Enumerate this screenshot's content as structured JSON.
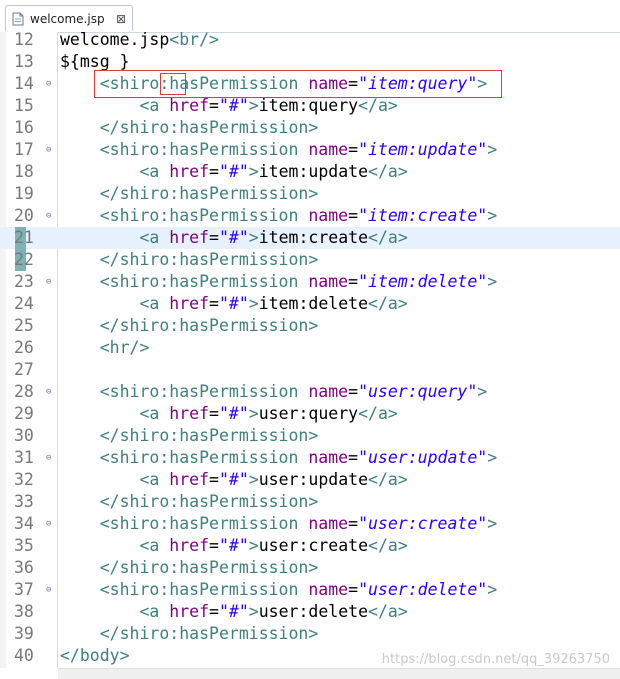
{
  "tab": {
    "title": "welcome.jsp",
    "close": "⊠"
  },
  "lines": [
    {
      "n": "12",
      "fold": "",
      "parts": [
        [
          "txt",
          "welcome.jsp"
        ],
        [
          "tag",
          "<br/>"
        ]
      ]
    },
    {
      "n": "13",
      "fold": "",
      "parts": [
        [
          "txt",
          "${msg }"
        ]
      ]
    },
    {
      "n": "14",
      "fold": "⊖",
      "parts": [
        [
          "txt",
          "    "
        ],
        [
          "tag",
          "<shiro:hasPermission "
        ],
        [
          "attr",
          "name"
        ],
        [
          "txt",
          "="
        ],
        [
          "str",
          "\"item:query\""
        ],
        [
          "tag",
          ">"
        ]
      ]
    },
    {
      "n": "15",
      "fold": "",
      "parts": [
        [
          "txt",
          "        "
        ],
        [
          "tag",
          "<a "
        ],
        [
          "attr",
          "href"
        ],
        [
          "txt",
          "="
        ],
        [
          "str",
          "\"#\""
        ],
        [
          "tag",
          ">"
        ],
        [
          "txt",
          "item:query"
        ],
        [
          "tag",
          "</a>"
        ]
      ]
    },
    {
      "n": "16",
      "fold": "",
      "parts": [
        [
          "txt",
          "    "
        ],
        [
          "tag",
          "</shiro:hasPermission>"
        ]
      ]
    },
    {
      "n": "17",
      "fold": "⊖",
      "parts": [
        [
          "txt",
          "    "
        ],
        [
          "tag",
          "<shiro:hasPermission "
        ],
        [
          "attr",
          "name"
        ],
        [
          "txt",
          "="
        ],
        [
          "str",
          "\"item:update\""
        ],
        [
          "tag",
          ">"
        ]
      ]
    },
    {
      "n": "18",
      "fold": "",
      "parts": [
        [
          "txt",
          "        "
        ],
        [
          "tag",
          "<a "
        ],
        [
          "attr",
          "href"
        ],
        [
          "txt",
          "="
        ],
        [
          "str",
          "\"#\""
        ],
        [
          "tag",
          ">"
        ],
        [
          "txt",
          "item:update"
        ],
        [
          "tag",
          "</a>"
        ]
      ]
    },
    {
      "n": "19",
      "fold": "",
      "parts": [
        [
          "txt",
          "    "
        ],
        [
          "tag",
          "</shiro:hasPermission>"
        ]
      ]
    },
    {
      "n": "20",
      "fold": "⊖",
      "parts": [
        [
          "txt",
          "    "
        ],
        [
          "tag",
          "<shiro:hasPermission "
        ],
        [
          "attr",
          "name"
        ],
        [
          "txt",
          "="
        ],
        [
          "str",
          "\"item:create\""
        ],
        [
          "tag",
          ">"
        ]
      ]
    },
    {
      "n": "21",
      "fold": "",
      "current": true,
      "parts": [
        [
          "txt",
          "        "
        ],
        [
          "tag",
          "<a "
        ],
        [
          "attr",
          "href"
        ],
        [
          "txt",
          "="
        ],
        [
          "str",
          "\"#\""
        ],
        [
          "tag",
          ">"
        ],
        [
          "txt",
          "item:create"
        ],
        [
          "tag",
          "</a>"
        ]
      ]
    },
    {
      "n": "22",
      "fold": "",
      "parts": [
        [
          "txt",
          "    "
        ],
        [
          "tag",
          "</shiro:hasPermission>"
        ]
      ]
    },
    {
      "n": "23",
      "fold": "⊖",
      "parts": [
        [
          "txt",
          "    "
        ],
        [
          "tag",
          "<shiro:hasPermission "
        ],
        [
          "attr",
          "name"
        ],
        [
          "txt",
          "="
        ],
        [
          "str",
          "\"item:delete\""
        ],
        [
          "tag",
          ">"
        ]
      ]
    },
    {
      "n": "24",
      "fold": "",
      "parts": [
        [
          "txt",
          "        "
        ],
        [
          "tag",
          "<a "
        ],
        [
          "attr",
          "href"
        ],
        [
          "txt",
          "="
        ],
        [
          "str",
          "\"#\""
        ],
        [
          "tag",
          ">"
        ],
        [
          "txt",
          "item:delete"
        ],
        [
          "tag",
          "</a>"
        ]
      ]
    },
    {
      "n": "25",
      "fold": "",
      "parts": [
        [
          "txt",
          "    "
        ],
        [
          "tag",
          "</shiro:hasPermission>"
        ]
      ]
    },
    {
      "n": "26",
      "fold": "",
      "parts": [
        [
          "txt",
          "    "
        ],
        [
          "tag",
          "<hr/>"
        ]
      ]
    },
    {
      "n": "27",
      "fold": "",
      "parts": []
    },
    {
      "n": "28",
      "fold": "⊖",
      "parts": [
        [
          "txt",
          "    "
        ],
        [
          "tag",
          "<shiro:hasPermission "
        ],
        [
          "attr",
          "name"
        ],
        [
          "txt",
          "="
        ],
        [
          "str",
          "\"user:query\""
        ],
        [
          "tag",
          ">"
        ]
      ]
    },
    {
      "n": "29",
      "fold": "",
      "parts": [
        [
          "txt",
          "        "
        ],
        [
          "tag",
          "<a "
        ],
        [
          "attr",
          "href"
        ],
        [
          "txt",
          "="
        ],
        [
          "str",
          "\"#\""
        ],
        [
          "tag",
          ">"
        ],
        [
          "txt",
          "user:query"
        ],
        [
          "tag",
          "</a>"
        ]
      ]
    },
    {
      "n": "30",
      "fold": "",
      "parts": [
        [
          "txt",
          "    "
        ],
        [
          "tag",
          "</shiro:hasPermission>"
        ]
      ]
    },
    {
      "n": "31",
      "fold": "⊖",
      "parts": [
        [
          "txt",
          "    "
        ],
        [
          "tag",
          "<shiro:hasPermission "
        ],
        [
          "attr",
          "name"
        ],
        [
          "txt",
          "="
        ],
        [
          "str",
          "\"user:update\""
        ],
        [
          "tag",
          ">"
        ]
      ]
    },
    {
      "n": "32",
      "fold": "",
      "parts": [
        [
          "txt",
          "        "
        ],
        [
          "tag",
          "<a "
        ],
        [
          "attr",
          "href"
        ],
        [
          "txt",
          "="
        ],
        [
          "str",
          "\"#\""
        ],
        [
          "tag",
          ">"
        ],
        [
          "txt",
          "user:update"
        ],
        [
          "tag",
          "</a>"
        ]
      ]
    },
    {
      "n": "33",
      "fold": "",
      "parts": [
        [
          "txt",
          "    "
        ],
        [
          "tag",
          "</shiro:hasPermission>"
        ]
      ]
    },
    {
      "n": "34",
      "fold": "⊖",
      "parts": [
        [
          "txt",
          "    "
        ],
        [
          "tag",
          "<shiro:hasPermission "
        ],
        [
          "attr",
          "name"
        ],
        [
          "txt",
          "="
        ],
        [
          "str",
          "\"user:create\""
        ],
        [
          "tag",
          ">"
        ]
      ]
    },
    {
      "n": "35",
      "fold": "",
      "parts": [
        [
          "txt",
          "        "
        ],
        [
          "tag",
          "<a "
        ],
        [
          "attr",
          "href"
        ],
        [
          "txt",
          "="
        ],
        [
          "str",
          "\"#\""
        ],
        [
          "tag",
          ">"
        ],
        [
          "txt",
          "user:create"
        ],
        [
          "tag",
          "</a>"
        ]
      ]
    },
    {
      "n": "36",
      "fold": "",
      "parts": [
        [
          "txt",
          "    "
        ],
        [
          "tag",
          "</shiro:hasPermission>"
        ]
      ]
    },
    {
      "n": "37",
      "fold": "⊖",
      "parts": [
        [
          "txt",
          "    "
        ],
        [
          "tag",
          "<shiro:hasPermission "
        ],
        [
          "attr",
          "name"
        ],
        [
          "txt",
          "="
        ],
        [
          "str",
          "\"user:delete\""
        ],
        [
          "tag",
          ">"
        ]
      ]
    },
    {
      "n": "38",
      "fold": "",
      "parts": [
        [
          "txt",
          "        "
        ],
        [
          "tag",
          "<a "
        ],
        [
          "attr",
          "href"
        ],
        [
          "txt",
          "="
        ],
        [
          "str",
          "\"#\""
        ],
        [
          "tag",
          ">"
        ],
        [
          "txt",
          "user:delete"
        ],
        [
          "tag",
          "</a>"
        ]
      ]
    },
    {
      "n": "39",
      "fold": "",
      "parts": [
        [
          "txt",
          "    "
        ],
        [
          "tag",
          "</shiro:hasPermission>"
        ]
      ]
    },
    {
      "n": "40",
      "fold": "",
      "parts": [
        [
          "tag",
          "</body>"
        ]
      ]
    }
  ],
  "watermark": "https://blog.csdn.net/qq_39263750",
  "colors": {
    "tag": "#3f7f7f",
    "attr": "#7f007f",
    "string": "#2a00ff",
    "highlight": "#e03b3b",
    "current_line": "#e8f2fe"
  }
}
